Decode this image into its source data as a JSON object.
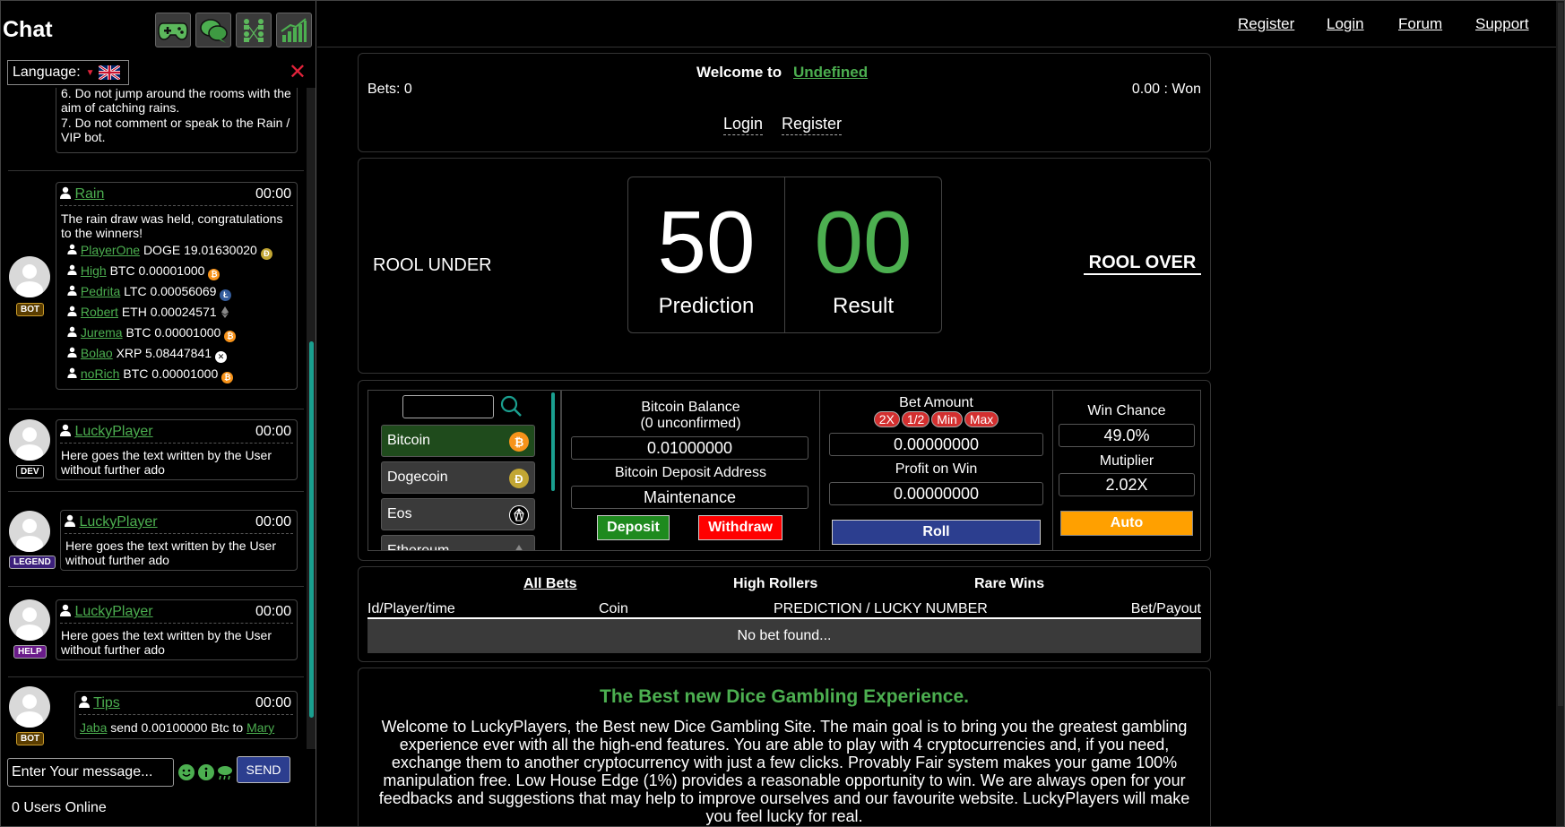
{
  "sidebar": {
    "title": "Chat",
    "language_label": "Language:",
    "language_close": "✕",
    "rules": [
      "6. Do not jump around the rooms with the aim of catching rains.",
      "7. Do not comment or speak to the Rain / VIP bot."
    ],
    "messages": [
      {
        "user": "Rain",
        "time": "00:00",
        "badge": "BOT",
        "text": "The rain draw was held, congratulations to the winners!",
        "winners": [
          {
            "name": "PlayerOne",
            "coin": "DOGE",
            "amount": "19.01630020"
          },
          {
            "name": "High",
            "coin": "BTC",
            "amount": "0.00001000"
          },
          {
            "name": "Pedrita",
            "coin": "LTC",
            "amount": "0.00056069"
          },
          {
            "name": "Robert",
            "coin": "ETH",
            "amount": "0.00024571"
          },
          {
            "name": "Jurema",
            "coin": "BTC",
            "amount": "0.00001000"
          },
          {
            "name": "Bolao",
            "coin": "XRP",
            "amount": "5.08447841"
          },
          {
            "name": "noRich",
            "coin": "BTC",
            "amount": "0.00001000"
          }
        ]
      },
      {
        "user": "LuckyPlayer",
        "time": "00:00",
        "badge": "DEV",
        "text": "Here goes the text written by the User without further ado"
      },
      {
        "user": "LuckyPlayer",
        "time": "00:00",
        "badge": "LEGEND",
        "text": "Here goes the text written by the User without further ado"
      },
      {
        "user": "LuckyPlayer",
        "time": "00:00",
        "badge": "HELP",
        "text": "Here goes the text written by the User without further ado"
      },
      {
        "user": "Tips",
        "time": "00:00",
        "badge": "BOT",
        "tip_from": "Jaba",
        "tip_text_1": "send",
        "tip_amount": "0.00100000 Btc",
        "tip_text_2": "to",
        "tip_to": "Mary"
      }
    ],
    "input_placeholder": "Enter Your message...",
    "send_label": "SEND",
    "users_online": "0 Users Online"
  },
  "nav": {
    "register": "Register",
    "login": "Login",
    "forum": "Forum",
    "support": "Support"
  },
  "welcome": {
    "text": "Welcome to",
    "name": "Undefined",
    "bets": "Bets: 0",
    "won": "0.00 : Won",
    "login": "Login",
    "register": "Register"
  },
  "game": {
    "roll_under": "ROOL UNDER",
    "roll_over": "ROOL OVER",
    "prediction_value": "50",
    "prediction_label": "Prediction",
    "result_value": "00",
    "result_label": "Result"
  },
  "wallet": {
    "coins": [
      "Bitcoin",
      "Dogecoin",
      "Eos",
      "Ethereum"
    ],
    "balance_title": "Bitcoin Balance",
    "balance_sub": "(0 unconfirmed)",
    "balance_value": "0.01000000",
    "deposit_address_label": "Bitcoin Deposit Address",
    "deposit_address_value": "Maintenance",
    "deposit": "Deposit",
    "withdraw": "Withdraw"
  },
  "bet": {
    "amount_label": "Bet Amount",
    "pills": [
      "2X",
      "1/2",
      "Min",
      "Max"
    ],
    "amount_value": "0.00000000",
    "profit_label": "Profit on Win",
    "profit_value": "0.00000000",
    "roll": "Roll"
  },
  "chance": {
    "label": "Win Chance",
    "value": "49.0%",
    "multiplier_label": "Mutiplier",
    "multiplier_value": "2.02X",
    "auto": "Auto"
  },
  "bets_table": {
    "tabs": [
      "All Bets",
      "High Rollers",
      "Rare Wins"
    ],
    "columns": [
      "Id/Player/time",
      "Coin",
      "PREDICTION / LUCKY NUMBER",
      "Bet/Payout"
    ],
    "empty": "No bet found..."
  },
  "info": {
    "title": "The Best new Dice Gambling Experience.",
    "text": "Welcome to LuckyPlayers, the Best new Dice Gambling Site. The main goal is to bring you the greatest gambling experience ever with all the high-end features. You are able to play with 4 cryptocurrencies and, if you need, exchange them to another cryptocurrency with just a few clicks. Provably Fair system makes your game 100% manipulation free. Low House Edge (1%) provides a reasonable opportunity to win. We are always open for your feedbacks and suggestions that may help to improve ourselves and our favourite website. LuckyPlayers will make you feel lucky for real."
  },
  "colors": {
    "accent_green": "#4caf50",
    "danger": "#d32f2f",
    "roll_blue": "#2c3e8f",
    "auto_orange": "#ffa000",
    "deposit_green": "#1e8a1e"
  }
}
